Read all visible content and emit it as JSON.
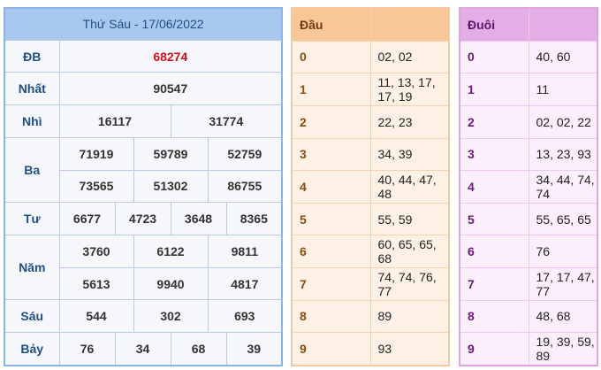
{
  "results": {
    "title": "Thứ Sáu - 17/06/2022",
    "db": {
      "label": "ĐB",
      "values": [
        "68274"
      ]
    },
    "g1": {
      "label": "Nhất",
      "values": [
        "90547"
      ]
    },
    "g2": {
      "label": "Nhì",
      "values": [
        "16117",
        "31774"
      ]
    },
    "g3": {
      "label": "Ba",
      "values": [
        "71919",
        "59789",
        "52759",
        "73565",
        "51302",
        "86755"
      ]
    },
    "g4": {
      "label": "Tư",
      "values": [
        "6677",
        "4723",
        "3648",
        "8365"
      ]
    },
    "g5": {
      "label": "Năm",
      "values": [
        "3760",
        "6122",
        "9811",
        "5613",
        "9940",
        "4817"
      ]
    },
    "g6": {
      "label": "Sáu",
      "values": [
        "544",
        "302",
        "693"
      ]
    },
    "g7": {
      "label": "Bảy",
      "values": [
        "76",
        "34",
        "68",
        "39"
      ]
    }
  },
  "dau": {
    "title": "Đầu",
    "rows": [
      {
        "key": "0",
        "value": "02, 02"
      },
      {
        "key": "1",
        "value": "11, 13, 17, 17, 19"
      },
      {
        "key": "2",
        "value": "22, 23"
      },
      {
        "key": "3",
        "value": "34, 39"
      },
      {
        "key": "4",
        "value": "40, 44, 47, 48"
      },
      {
        "key": "5",
        "value": "55, 59"
      },
      {
        "key": "6",
        "value": "60, 65, 65, 68"
      },
      {
        "key": "7",
        "value": "74, 74, 76, 77"
      },
      {
        "key": "8",
        "value": "89"
      },
      {
        "key": "9",
        "value": "93"
      }
    ]
  },
  "duoi": {
    "title": "Đuôi",
    "rows": [
      {
        "key": "0",
        "value": "40, 60"
      },
      {
        "key": "1",
        "value": "11"
      },
      {
        "key": "2",
        "value": "02, 02, 22"
      },
      {
        "key": "3",
        "value": "13, 23, 93"
      },
      {
        "key": "4",
        "value": "34, 44, 74, 74"
      },
      {
        "key": "5",
        "value": "55, 65, 65"
      },
      {
        "key": "6",
        "value": "76"
      },
      {
        "key": "7",
        "value": "17, 17, 47, 77"
      },
      {
        "key": "8",
        "value": "48, 68"
      },
      {
        "key": "9",
        "value": "19, 39, 59, 89"
      }
    ]
  },
  "colors": {
    "special_prize": "#d6101a",
    "results_header": "#a9c8ef",
    "dau_header": "#f8c796",
    "duoi_header": "#e3aee6"
  }
}
